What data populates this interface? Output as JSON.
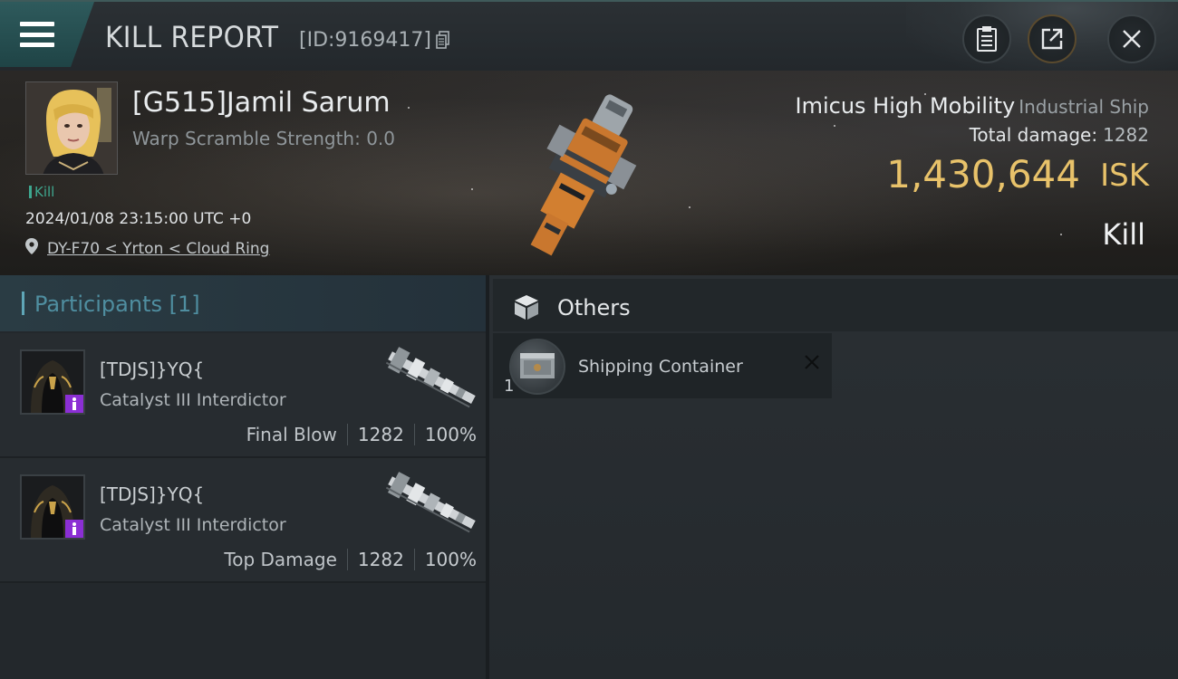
{
  "header": {
    "title": "KILL REPORT",
    "report_id": "[ID:9169417]"
  },
  "victim": {
    "name": "[G515]Jamil Sarum",
    "warp_scramble": "Warp Scramble Strength: 0.0",
    "tag": "Kill",
    "timestamp": "2024/01/08 23:15:00 UTC +0",
    "location": "DY-F70 < Yrton < Cloud Ring"
  },
  "ship": {
    "name": "Imicus High Mobility",
    "class": "Industrial Ship",
    "total_damage_label": "Total damage:",
    "total_damage": "1282",
    "isk_value": "1,430,644",
    "isk_unit": "ISK",
    "result": "Kill"
  },
  "participants": {
    "title": "Participants [1]",
    "rows": [
      {
        "name": "[TDJS]}YQ{",
        "ship": "Catalyst III Interdictor",
        "label": "Final Blow",
        "damage": "1282",
        "percent": "100%"
      },
      {
        "name": "[TDJS]}YQ{",
        "ship": "Catalyst III Interdictor",
        "label": "Top Damage",
        "damage": "1282",
        "percent": "100%"
      }
    ]
  },
  "others": {
    "title": "Others",
    "items": [
      {
        "quantity": "1",
        "name": "Shipping Container"
      }
    ]
  },
  "colors": {
    "accent_teal": "#2e5a5c",
    "isk_gold": "#e8c26a",
    "kill_green": "#3ea78f",
    "badge_purple": "#8b2fd4"
  },
  "icons": {
    "menu": "menu-icon",
    "copy": "copy-icon",
    "report": "clipboard-icon",
    "share": "share-icon",
    "close": "close-icon",
    "location": "map-pin-icon",
    "others": "box-icon",
    "remove": "close-icon"
  }
}
